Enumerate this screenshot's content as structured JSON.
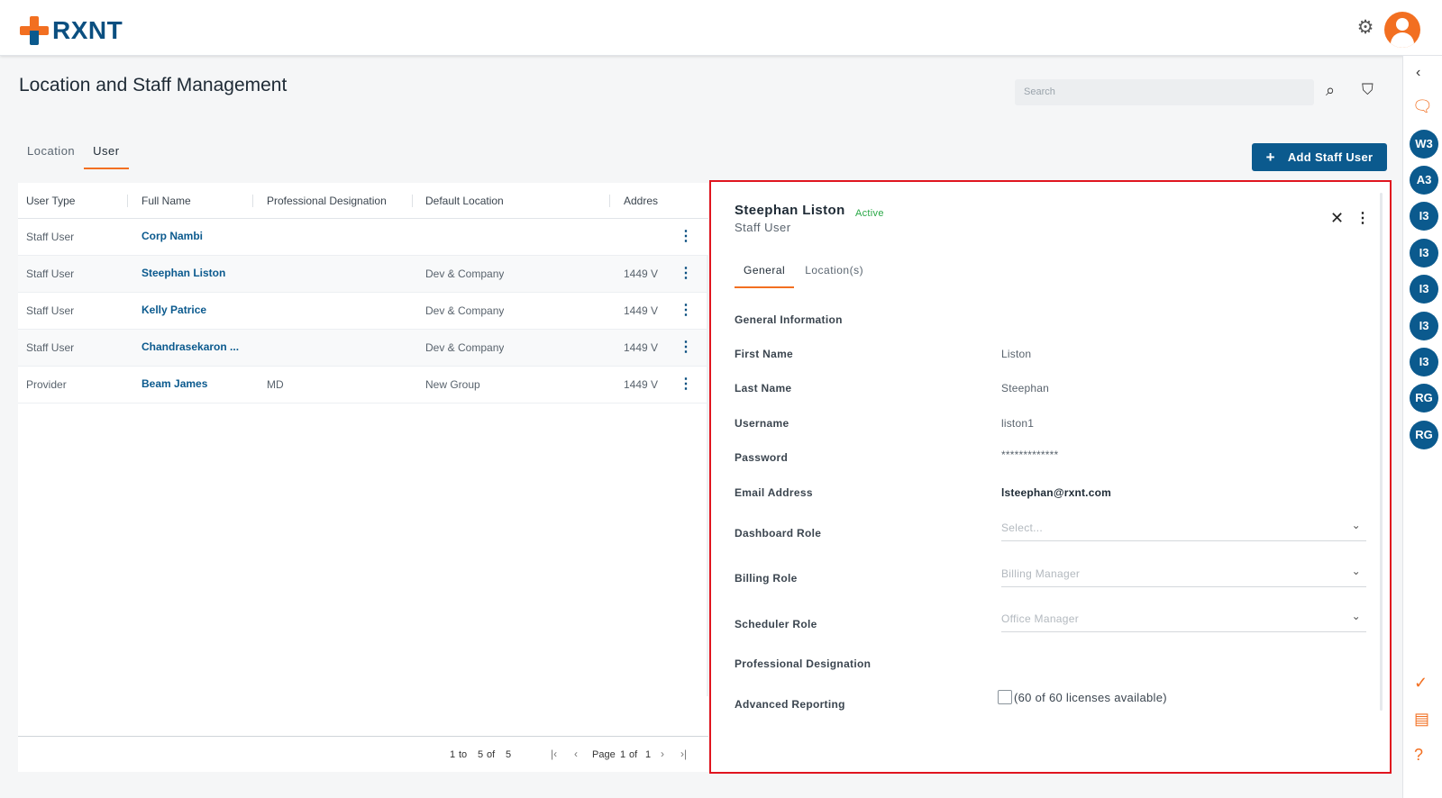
{
  "brand": {
    "name": "RXNT"
  },
  "page": {
    "title": "Location and Staff Management"
  },
  "search": {
    "placeholder": "Search"
  },
  "tabs": [
    {
      "label": "Location"
    },
    {
      "label": "User"
    }
  ],
  "add_button": {
    "label": "Add Staff User"
  },
  "table": {
    "columns": [
      "User Type",
      "Full Name",
      "Professional Designation",
      "Default Location",
      "Addres"
    ],
    "rows": [
      {
        "user_type": "Staff User",
        "full_name": "Corp Nambi",
        "designation": "",
        "location": "",
        "address": ""
      },
      {
        "user_type": "Staff User",
        "full_name": "Steephan Liston",
        "designation": "",
        "location": "Dev & Company",
        "address": "1449 V"
      },
      {
        "user_type": "Staff User",
        "full_name": "Kelly Patrice",
        "designation": "",
        "location": "Dev & Company",
        "address": "1449 V"
      },
      {
        "user_type": "Staff User",
        "full_name": "Chandrasekaron ...",
        "designation": "",
        "location": "Dev & Company",
        "address": "1449 V"
      },
      {
        "user_type": "Provider",
        "full_name": "Beam James",
        "designation": "MD",
        "location": "New Group",
        "address": "1449 V"
      }
    ],
    "pagination": {
      "from": "1",
      "to_label": "to",
      "to": "5",
      "of_label": "of",
      "total": "5",
      "page_label": "Page",
      "page": "1",
      "page_of_label": "of",
      "pages": "1"
    }
  },
  "detail": {
    "name": "Steephan Liston",
    "status": "Active",
    "user_type": "Staff User",
    "tabs": [
      {
        "label": "General"
      },
      {
        "label": "Location(s)"
      }
    ],
    "section_title": "General Information",
    "fields": {
      "first_name": {
        "label": "First Name",
        "value": "Liston"
      },
      "last_name": {
        "label": "Last Name",
        "value": "Steephan"
      },
      "username": {
        "label": "Username",
        "value": "liston1"
      },
      "password": {
        "label": "Password",
        "value": "*************"
      },
      "email": {
        "label": "Email Address",
        "value": "lsteephan@rxnt.com"
      },
      "dashboard_role": {
        "label": "Dashboard Role",
        "value": "Select..."
      },
      "billing_role": {
        "label": "Billing Role",
        "value": "Billing Manager"
      },
      "scheduler_role": {
        "label": "Scheduler Role",
        "value": "Office Manager"
      },
      "professional_designation": {
        "label": "Professional Designation",
        "value": ""
      },
      "advanced_reporting": {
        "label": "Advanced Reporting",
        "value": "(60 of 60 licenses available)",
        "checked": false
      }
    }
  },
  "rail": {
    "badges": [
      "W3",
      "A3",
      "I3",
      "I3",
      "I3",
      "I3",
      "I3",
      "RG",
      "RG"
    ]
  },
  "colors": {
    "accent": "#f26f21",
    "primary": "#0b5a8e",
    "highlight_border": "#e0151f",
    "status_active": "#28a745"
  },
  "icons": [
    "gear-icon",
    "avatar-icon",
    "search-icon",
    "filter-icon",
    "close-icon",
    "kebab-icon",
    "chevron-down-icon",
    "chat-icon",
    "task-icon",
    "message-icon",
    "help-icon"
  ]
}
